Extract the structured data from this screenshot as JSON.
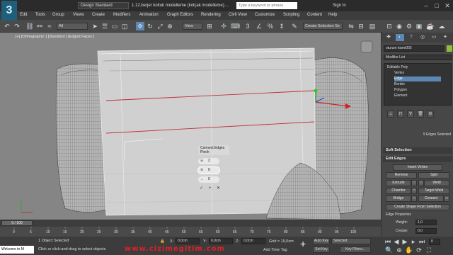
{
  "app": {
    "logo": "3",
    "workspace": "Design Standard",
    "document_title": "1.12.berjer koltuk modelleme (kolçak modelleme)....",
    "search_placeholder": "Type a keyword or phrase",
    "signin": "Sign In"
  },
  "menu": [
    "Edit",
    "Tools",
    "Group",
    "Views",
    "Create",
    "Modifiers",
    "Animation",
    "Graph Editors",
    "Rendering",
    "Civil View",
    "Customize",
    "Scripting",
    "Content",
    "Help"
  ],
  "toolbar": {
    "filter": "All",
    "view": "View",
    "selection_set": "Create Selection Se"
  },
  "viewport": {
    "label": "[+] [Orthographic ] [Standard ] [Edged Faces ]",
    "caddy": {
      "title": "Connect Edges",
      "subtitle": "Pinch",
      "segments": "2",
      "pinch": "0",
      "slide": "0",
      "ok_icon": "check-icon",
      "apply_icon": "plus-icon",
      "cancel_icon": "close-icon"
    }
  },
  "right_panel": {
    "object_name": "oturum kismi002",
    "object_color": "#8fbf3a",
    "modifier_list": "Modifier List",
    "stack": [
      "Editable Poly",
      "Vertex",
      "Edge",
      "Border",
      "Polygon",
      "Element"
    ],
    "stack_selected": "Edge",
    "selection_info": "9 Edges Selected",
    "soft_selection": "Soft Selection",
    "edit_edges": {
      "title": "Edit Edges",
      "insert_vertex": "Insert Vertex",
      "remove": "Remove",
      "split": "Split",
      "extrude": "Extrude",
      "weld": "Weld",
      "chamfer": "Chamfer",
      "target_weld": "Target Weld",
      "bridge": "Bridge",
      "connect": "Connect",
      "create_shape": "Create Shape From Selection",
      "edge_properties": "Edge Properties",
      "weight_label": "Weight:",
      "weight_value": "1,0",
      "crease_label": "Crease:",
      "crease_value": "0,0"
    }
  },
  "timeline": {
    "slider": "0 / 100",
    "ticks": [
      "0",
      "5",
      "10",
      "15",
      "20",
      "25",
      "30",
      "35",
      "40",
      "45",
      "50",
      "55",
      "60",
      "65",
      "70",
      "75",
      "80",
      "85",
      "90",
      "95",
      "100"
    ]
  },
  "status": {
    "maxscript": "Welcome to M",
    "selected": "1 Object Selected",
    "hint": "Click or click-and-drag to select objects",
    "x_label": "X:",
    "x_value": "0,0cm",
    "y_label": "Y:",
    "y_value": "0,0cm",
    "z_label": "Z:",
    "z_value": "0,0cm",
    "grid": "Grid = 10,0cm",
    "add_time_tag": "Add Time Tag",
    "auto_key": "Auto Key",
    "selected_dropdown": "Selected",
    "set_key": "Set Key",
    "key_filters": "Key Filters...",
    "frame": "0"
  },
  "watermark": "www.cizimegitim.com"
}
